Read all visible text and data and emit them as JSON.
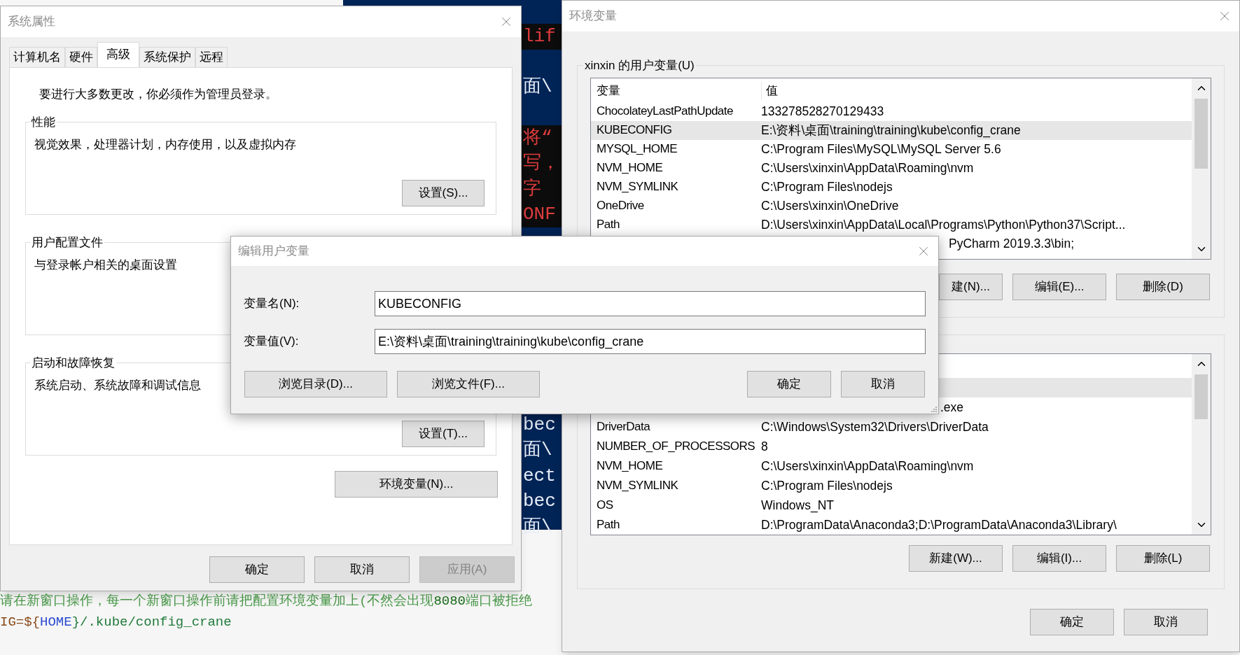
{
  "code_editor": {
    "dark_groups": [
      [
        {
          "text": "lif",
          "band": true
        }
      ],
      [
        {
          "text": "面\\",
          "band": false
        }
      ],
      [
        {
          "text": "将“",
          "band": true
        },
        {
          "text": "写，",
          "band": true
        },
        {
          "text": "字",
          "band": true
        },
        {
          "text": "ONF",
          "band": true
        }
      ],
      [
        {
          "text": "bec",
          "band": false
        },
        {
          "text": "面\\",
          "band": false
        },
        {
          "text": "ect",
          "band": false
        },
        {
          "text": "bec",
          "band": false
        },
        {
          "text": "面\\",
          "band": false
        }
      ]
    ],
    "light_lines": [
      {
        "segments": [
          {
            "text": "请在新窗口操作，每一个新窗口操作前请把配置环境变量加上(不然会出现",
            "color": "#4a9a4a"
          },
          {
            "text": "8080",
            "color": "#1a6e1a"
          },
          {
            "text": "端口被拒绝",
            "color": "#4a9a4a"
          }
        ]
      },
      {
        "segments": [
          {
            "text": "IG=${",
            "color": "#8a4a1a"
          },
          {
            "text": "HOME",
            "color": "#2a4ad0"
          },
          {
            "text": "}/.kube/config_crane",
            "color": "#1f7a3a"
          }
        ]
      }
    ]
  },
  "system_properties": {
    "title": "系统属性",
    "tabs": [
      {
        "label": "计算机名",
        "selected": false
      },
      {
        "label": "硬件",
        "selected": false
      },
      {
        "label": "高级",
        "selected": true
      },
      {
        "label": "系统保护",
        "selected": false
      },
      {
        "label": "远程",
        "selected": false
      }
    ],
    "notice": "要进行大多数更改，你必须作为管理员登录。",
    "groups": [
      {
        "title": "性能",
        "description": "视觉效果，处理器计划，内存使用，以及虚拟内存",
        "button": "设置(S)..."
      },
      {
        "title": "用户配置文件",
        "description": "与登录帐户相关的桌面设置"
      },
      {
        "title": "启动和故障恢复",
        "description": "系统启动、系统故障和调试信息",
        "button": "设置(T)..."
      }
    ],
    "env_button": "环境变量(N)...",
    "buttons": [
      {
        "label": "确定",
        "disabled": false
      },
      {
        "label": "取消",
        "disabled": false
      },
      {
        "label": "应用(A)",
        "disabled": true
      }
    ]
  },
  "environment_variables": {
    "title": "环境变量",
    "user_group": {
      "title": "xinxin 的用户变量(U)",
      "columns": [
        "变量",
        "值"
      ],
      "rows": [
        {
          "name": "ChocolateyLastPathUpdate",
          "value": "133278528270129433",
          "selected": false
        },
        {
          "name": "KUBECONFIG",
          "value": "E:\\资料\\桌面\\training\\training\\kube\\config_crane",
          "selected": true
        },
        {
          "name": "MYSQL_HOME",
          "value": "C:\\Program Files\\MySQL\\MySQL Server 5.6",
          "selected": false
        },
        {
          "name": "NVM_HOME",
          "value": "C:\\Users\\xinxin\\AppData\\Roaming\\nvm",
          "selected": false
        },
        {
          "name": "NVM_SYMLINK",
          "value": "C:\\Program Files\\nodejs",
          "selected": false
        },
        {
          "name": "OneDrive",
          "value": "C:\\Users\\xinxin\\OneDrive",
          "selected": false
        },
        {
          "name": "Path",
          "value": "D:\\Users\\xinxin\\AppData\\Local\\Programs\\Python\\Python37\\Script...",
          "selected": false
        },
        {
          "value": "PyCharm 2019.3.3\\bin;",
          "selected": false
        }
      ],
      "buttons": [
        "建(N)...",
        "编辑(E)...",
        "删除(D)"
      ]
    },
    "system_group": {
      "rows": [
        {
          "selected": true
        },
        {
          "value": ".exe",
          "selected": false
        },
        {
          "name": "DriverData",
          "value": "C:\\Windows\\System32\\Drivers\\DriverData",
          "selected": false
        },
        {
          "name": "NUMBER_OF_PROCESSORS",
          "value": "8",
          "selected": false
        },
        {
          "name": "NVM_HOME",
          "value": "C:\\Users\\xinxin\\AppData\\Roaming\\nvm",
          "selected": false
        },
        {
          "name": "NVM_SYMLINK",
          "value": "C:\\Program Files\\nodejs",
          "selected": false
        },
        {
          "name": "OS",
          "value": "Windows_NT",
          "selected": false
        },
        {
          "name": "Path",
          "value": "D:\\ProgramData\\Anaconda3;D:\\ProgramData\\Anaconda3\\Library\\",
          "selected": false
        }
      ],
      "buttons": [
        "新建(W)...",
        "编辑(I)...",
        "删除(L)"
      ]
    },
    "buttons": [
      "确定",
      "取消"
    ]
  },
  "edit_dialog": {
    "title": "编辑用户变量",
    "fields": [
      {
        "label": "变量名(N):",
        "value": "KUBECONFIG"
      },
      {
        "label": "变量值(V):",
        "value": "E:\\资料\\桌面\\training\\training\\kube\\config_crane"
      }
    ],
    "left_buttons": [
      "浏览目录(D)...",
      "浏览文件(F)..."
    ],
    "right_buttons": [
      "确定",
      "取消"
    ]
  }
}
